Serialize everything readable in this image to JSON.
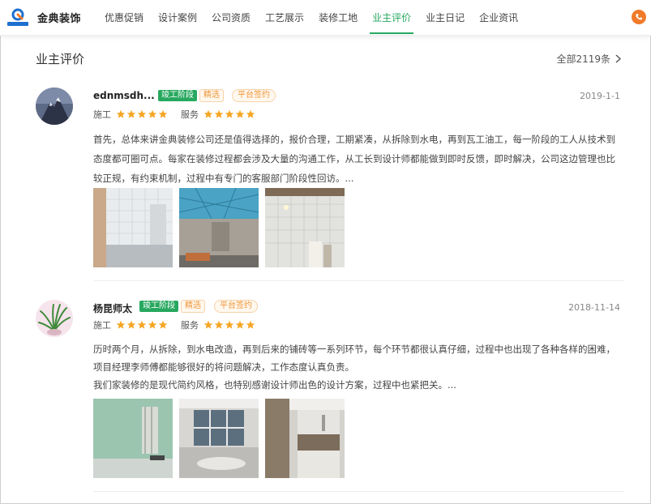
{
  "header": {
    "brand": "金典装饰",
    "nav": [
      {
        "label": "优惠促销",
        "active": false
      },
      {
        "label": "设计案例",
        "active": false
      },
      {
        "label": "公司资质",
        "active": false
      },
      {
        "label": "工艺展示",
        "active": false
      },
      {
        "label": "装修工地",
        "active": false
      },
      {
        "label": "业主评价",
        "active": true
      },
      {
        "label": "业主日记",
        "active": false
      },
      {
        "label": "企业资讯",
        "active": false
      }
    ],
    "logo_text": "金典装饰",
    "phone_icon": "phone-icon"
  },
  "section": {
    "title": "业主评价",
    "all_label": "全部2119条"
  },
  "reviews": [
    {
      "author": "ednmsdh...",
      "badges": {
        "stage": "竣工阶段",
        "pick": "精选",
        "sign": "平台签约"
      },
      "date": "2019-1-1",
      "rating_construction_label": "施工",
      "rating_service_label": "服务",
      "rating_construction": 5,
      "rating_service": 5,
      "text": "首先，总体来讲金典装修公司还是值得选择的，报价合理，工期紧凑，从拆除到水电，再到瓦工油工，每一阶段的工人从技术到态度都可圈可点。每家在装修过程都会涉及大量的沟通工作，从工长到设计师都能做到即时反馈，即时解决，公司这边管理也比较正规，有约束机制，过程中有专门的客服部门阶段性回访。..."
    },
    {
      "author": "杨昆师太",
      "badges": {
        "stage": "竣工阶段",
        "pick": "精选",
        "sign": "平台签约"
      },
      "date": "2018-11-14",
      "rating_construction_label": "施工",
      "rating_service_label": "服务",
      "rating_construction": 5,
      "rating_service": 5,
      "text": "历时两个月，从拆除，到水电改造，再到后来的铺砖等一系列环节，每个环节都很认真仔细，过程中也出现了各种各样的困难，项目经理李师傅都能够很好的将问题解决，工作态度认真负责。\n我们家装修的是现代简约风格，也特别感谢设计师出色的设计方案，过程中也紧把关。..."
    }
  ],
  "colors": {
    "accent": "#27a85f",
    "star": "#f5a623",
    "badge_orange": "#f0963a",
    "phone": "#f07a2a"
  }
}
